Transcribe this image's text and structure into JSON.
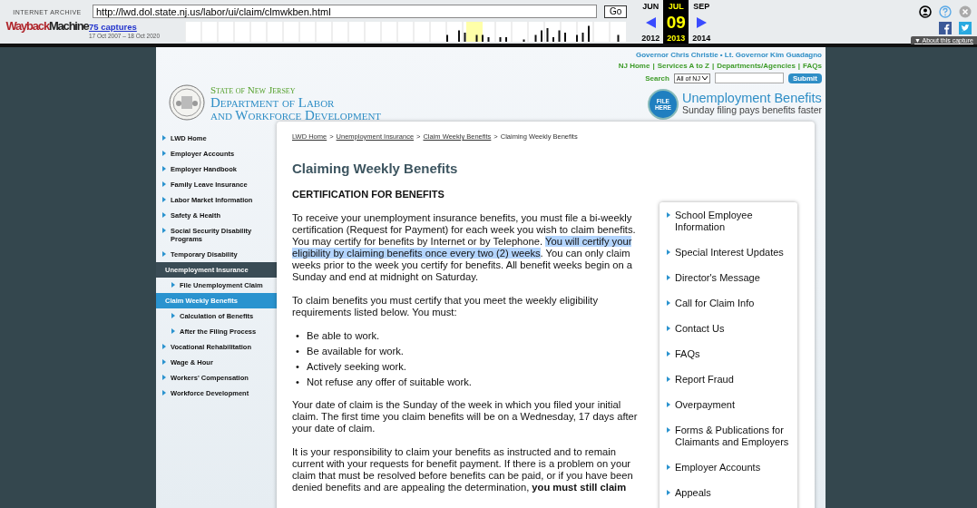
{
  "wayback": {
    "archive_label": "INTERNET ARCHIVE",
    "logo_left": "Wayback",
    "logo_right": "Machine",
    "url": "http://lwd.dol.state.nj.us/labor/ui/claim/clmwkben.html",
    "go": "Go",
    "captures": "75 captures",
    "range": "17 Oct 2007 – 18 Oct 2020",
    "months": [
      {
        "label": "JUN",
        "selected": false
      },
      {
        "label": "JUL",
        "selected": true
      },
      {
        "label": "SEP",
        "selected": false
      }
    ],
    "day": "09",
    "years": [
      {
        "label": "2012",
        "selected": false
      },
      {
        "label": "2013",
        "selected": true
      },
      {
        "label": "2014",
        "selected": false
      }
    ],
    "about_arrow": "▼",
    "about": "About this capture"
  },
  "header": {
    "officials": "Governor Chris Christie • Lt. Governor Kim Guadagno",
    "links": [
      "NJ Home",
      "Services A to Z",
      "Departments/Agencies",
      "FAQs"
    ],
    "link_separator": "|",
    "search_label": "Search",
    "search_scope": "All of NJ",
    "submit": "Submit",
    "state": "State of New Jersey",
    "dept_line1": "Department of Labor",
    "dept_line2": "and Workforce Development",
    "badge": [
      "FILE",
      "HERE"
    ],
    "banner_title": "Unemployment Benefits",
    "banner_sub": "Sunday filing pays benefits faster"
  },
  "sidebar": {
    "items": [
      {
        "label": "LWD Home",
        "selected": false
      },
      {
        "label": "Employer Accounts",
        "selected": false
      },
      {
        "label": "Employer Handbook",
        "selected": false
      },
      {
        "label": "Family Leave Insurance",
        "selected": false
      },
      {
        "label": "Labor Market Information",
        "selected": false
      },
      {
        "label": "Safety & Health",
        "selected": false
      },
      {
        "label": "Social Security Disability Programs",
        "selected": false
      },
      {
        "label": "Temporary Disability",
        "selected": false
      },
      {
        "label": "Unemployment Insurance",
        "selected": true,
        "children": [
          {
            "label": "File Unemployment Claim",
            "selected": false
          },
          {
            "label": "Claim Weekly Benefits",
            "selected": true
          },
          {
            "label": "Calculation of Benefits",
            "selected": false
          },
          {
            "label": "After the Filing Process",
            "selected": false
          }
        ]
      },
      {
        "label": "Vocational Rehabilitation",
        "selected": false
      },
      {
        "label": "Wage & Hour",
        "selected": false
      },
      {
        "label": "Workers' Compensation",
        "selected": false
      },
      {
        "label": "Workforce Development",
        "selected": false
      }
    ]
  },
  "breadcrumb": [
    {
      "label": "LWD Home",
      "link": true
    },
    {
      "label": "Unemployment Insurance",
      "link": true
    },
    {
      "label": "Claim Weekly Benefits",
      "link": true
    },
    {
      "label": "Claiming Weekly Benefits",
      "link": false
    }
  ],
  "breadcrumb_separator": ">",
  "title": "Claiming Weekly Benefits",
  "subtitle": "CERTIFICATION FOR BENEFITS",
  "content": [
    {
      "kind": "paragraph",
      "segments": [
        {
          "text": "To receive your unemployment insurance benefits, you must file a bi-weekly certification (Request for Payment) for each week you wish to claim benefits. You may certify for benefits by Internet or by Telephone. ",
          "highlighted": false
        },
        {
          "text": "You will certify your eligibility by claiming benefits once every two (2) weeks",
          "highlighted": true
        },
        {
          "text": ". You can only claim weeks prior to the week you certify for benefits. All benefit weeks begin on a Sunday and end at midnight on Saturday.",
          "highlighted": false
        }
      ]
    },
    {
      "kind": "paragraph",
      "segments": [
        {
          "text": "To claim benefits you must certify that you meet the weekly eligibility requirements listed below. You must:",
          "highlighted": false
        }
      ]
    },
    {
      "kind": "list",
      "bullet": "•",
      "items": [
        "Be able to work.",
        "Be available for work.",
        "Actively seeking work.",
        "Not refuse any offer of suitable work."
      ]
    },
    {
      "kind": "paragraph",
      "segments": [
        {
          "text": "Your date of claim is the Sunday of the week in which you filed your initial claim. The first time you claim benefits will be on a Wednesday, 17 days after your date of claim.",
          "highlighted": false
        }
      ]
    },
    {
      "kind": "paragraph",
      "segments": [
        {
          "text": "It is your responsibility to claim your benefits as instructed and to remain current with your requests for benefit payment. If there is a problem on your claim that must be resolved before benefits can be paid, or if you have been denied benefits and are appealing the determination, **you must still claim**",
          "highlighted": false
        }
      ]
    }
  ],
  "related": [
    "School Employee Information",
    "Special Interest Updates",
    "Director's Message",
    "Call for Claim Info",
    "Contact Us",
    "FAQs",
    "Report Fraud",
    "Overpayment",
    "Forms & Publications for Claimants and Employers",
    "Employer Accounts",
    "Appeals"
  ]
}
